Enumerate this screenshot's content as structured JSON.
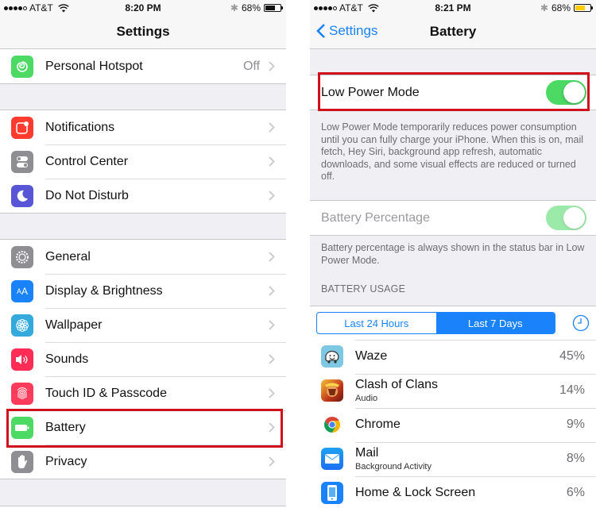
{
  "left": {
    "status": {
      "carrier": "AT&T",
      "time": "8:20 PM",
      "battery_pct": "68%",
      "battery_level": 0.68,
      "signal_bars": 4
    },
    "title": "Settings",
    "groups": [
      [
        {
          "id": "personal-hotspot",
          "label": "Personal Hotspot",
          "detail": "Off",
          "icon": "hotspot-icon",
          "color": "#4cd964"
        }
      ],
      [
        {
          "id": "notifications",
          "label": "Notifications",
          "icon": "notifications-icon",
          "color": "#ff3b30"
        },
        {
          "id": "control-center",
          "label": "Control Center",
          "icon": "control-center-icon",
          "color": "#8e8e93"
        },
        {
          "id": "do-not-disturb",
          "label": "Do Not Disturb",
          "icon": "moon-icon",
          "color": "#5856d6"
        }
      ],
      [
        {
          "id": "general",
          "label": "General",
          "icon": "gear-icon",
          "color": "#8e8e93"
        },
        {
          "id": "display-brightness",
          "label": "Display & Brightness",
          "icon": "text-size-icon",
          "color": "#1a82fb"
        },
        {
          "id": "wallpaper",
          "label": "Wallpaper",
          "icon": "wallpaper-icon",
          "color": "#34aadc"
        },
        {
          "id": "sounds",
          "label": "Sounds",
          "icon": "speaker-icon",
          "color": "#ff2d55"
        },
        {
          "id": "touch-id-passcode",
          "label": "Touch ID & Passcode",
          "icon": "fingerprint-icon",
          "color": "#ff3b5c"
        },
        {
          "id": "battery",
          "label": "Battery",
          "icon": "battery-icon",
          "color": "#4cd964"
        },
        {
          "id": "privacy",
          "label": "Privacy",
          "icon": "hand-icon",
          "color": "#8e8e93"
        }
      ]
    ]
  },
  "right": {
    "status": {
      "carrier": "AT&T",
      "time": "8:21 PM",
      "battery_pct": "68%",
      "battery_level": 0.68,
      "signal_bars": 4
    },
    "back_label": "Settings",
    "title": "Battery",
    "low_power": {
      "label": "Low Power Mode",
      "on": true
    },
    "low_power_footer": "Low Power Mode temporarily reduces power consumption until you can fully charge your iPhone. When this is on, mail fetch, Hey Siri, background app refresh, automatic downloads, and some visual effects are reduced or turned off.",
    "battery_percentage": {
      "label": "Battery Percentage",
      "on": true,
      "disabled": true
    },
    "battery_percentage_footer": "Battery percentage is always shown in the status bar in Low Power Mode.",
    "usage_header": "BATTERY USAGE",
    "segments": [
      {
        "label": "Last 24 Hours",
        "active": false
      },
      {
        "label": "Last 7 Days",
        "active": true
      }
    ],
    "usage": [
      {
        "name": "Waze",
        "sub": "",
        "pct": "45%",
        "icon": "waze-icon"
      },
      {
        "name": "Clash of Clans",
        "sub": "Audio",
        "pct": "14%",
        "icon": "clash-of-clans-icon"
      },
      {
        "name": "Chrome",
        "sub": "",
        "pct": "9%",
        "icon": "chrome-icon"
      },
      {
        "name": "Mail",
        "sub": "Background Activity",
        "pct": "8%",
        "icon": "mail-icon"
      },
      {
        "name": "Home & Lock Screen",
        "sub": "",
        "pct": "6%",
        "icon": "home-lock-screen-icon"
      }
    ]
  },
  "colors": {
    "accent": "#1a82fb",
    "toggle_on": "#4cd964",
    "highlight": "#d0101c",
    "low_power_battery": "#ffcc00"
  }
}
